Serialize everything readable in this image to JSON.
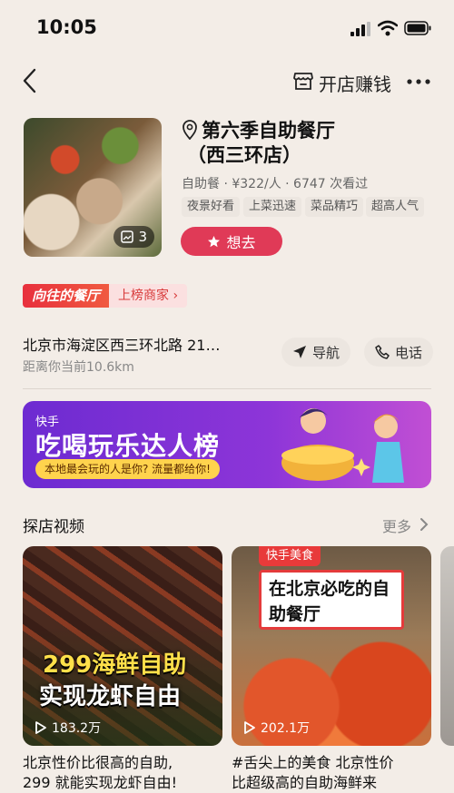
{
  "status": {
    "time": "10:05"
  },
  "nav": {
    "shop_label": "开店赚钱"
  },
  "shop": {
    "name_line1": "第六季自助餐厅",
    "name_line2": "（西三环店）",
    "meta": "自助餐 · ¥322/人 · 6747 次看过",
    "tags": [
      "夜景好看",
      "上菜迅速",
      "菜品精巧",
      "超高人气"
    ],
    "photo_count": "3",
    "want_label": "想去"
  },
  "rank": {
    "left": "向往的餐厅",
    "right": "上榜商家 ›"
  },
  "address": {
    "text": "北京市海淀区西三环北路 21…",
    "distance": "距离你当前10.6km",
    "navigate_label": "导航",
    "phone_label": "电话"
  },
  "promo": {
    "brand": "快手",
    "title": "吃喝玩乐达人榜",
    "subtitle": "本地最会玩的人是你? 流量都给你!"
  },
  "section": {
    "title": "探店视频",
    "more_label": "更多"
  },
  "videos": [
    {
      "overlay_line1": "299海鲜自助",
      "overlay_line2": "实现龙虾自由",
      "views": "183.2万",
      "caption": "北京性价比很高的自助,",
      "caption2": "299 就能实现龙虾自由!"
    },
    {
      "badge": "快手美食",
      "overlay_box": "在北京必吃的自助餐厅",
      "views": "202.1万",
      "caption": "#舌尖上的美食 北京性价",
      "caption2": "比超级高的自助海鲜来"
    }
  ],
  "colors": {
    "accent": "#e03a57",
    "promo": "#7b2fd6"
  }
}
